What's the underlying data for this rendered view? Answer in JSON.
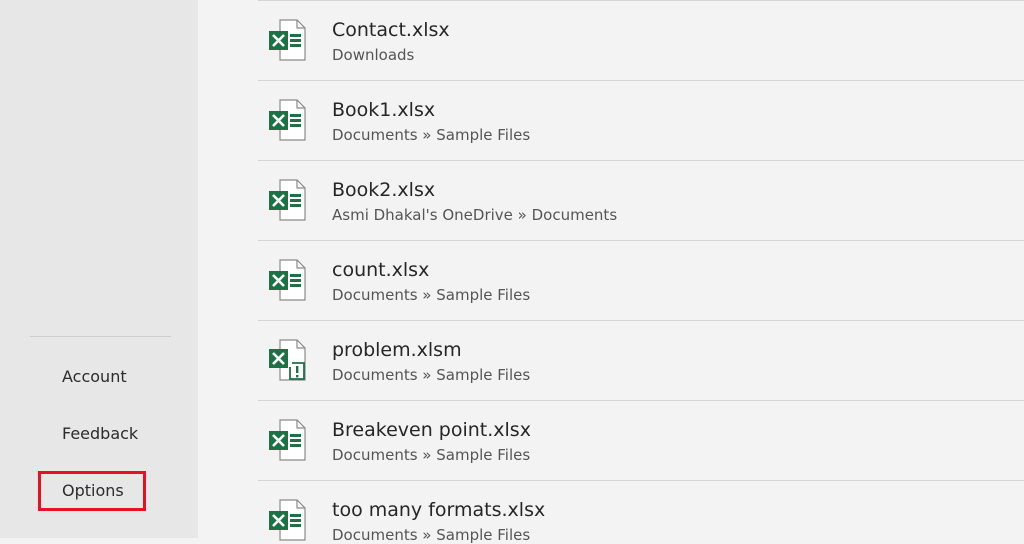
{
  "sidebar": {
    "items": [
      {
        "label": "Account"
      },
      {
        "label": "Feedback"
      },
      {
        "label": "Options"
      }
    ]
  },
  "colors": {
    "excel_green": "#1e7145",
    "highlight_red": "#e81123",
    "sidebar_bg": "#e7e7e8",
    "main_bg": "#f3f3f3"
  },
  "recent_files": [
    {
      "name": "Contact.xlsx",
      "path": "Downloads",
      "icon": "excel-file-icon"
    },
    {
      "name": "Book1.xlsx",
      "path": "Documents » Sample Files",
      "icon": "excel-file-icon"
    },
    {
      "name": "Book2.xlsx",
      "path": "Asmi Dhakal's OneDrive » Documents",
      "icon": "excel-file-icon"
    },
    {
      "name": "count.xlsx",
      "path": "Documents » Sample Files",
      "icon": "excel-file-icon"
    },
    {
      "name": "problem.xlsm",
      "path": "Documents » Sample Files",
      "icon": "excel-macro-file-icon"
    },
    {
      "name": "Breakeven point.xlsx",
      "path": "Documents » Sample Files",
      "icon": "excel-file-icon"
    },
    {
      "name": "too many formats.xlsx",
      "path": "Documents » Sample Files",
      "icon": "excel-file-icon"
    }
  ]
}
